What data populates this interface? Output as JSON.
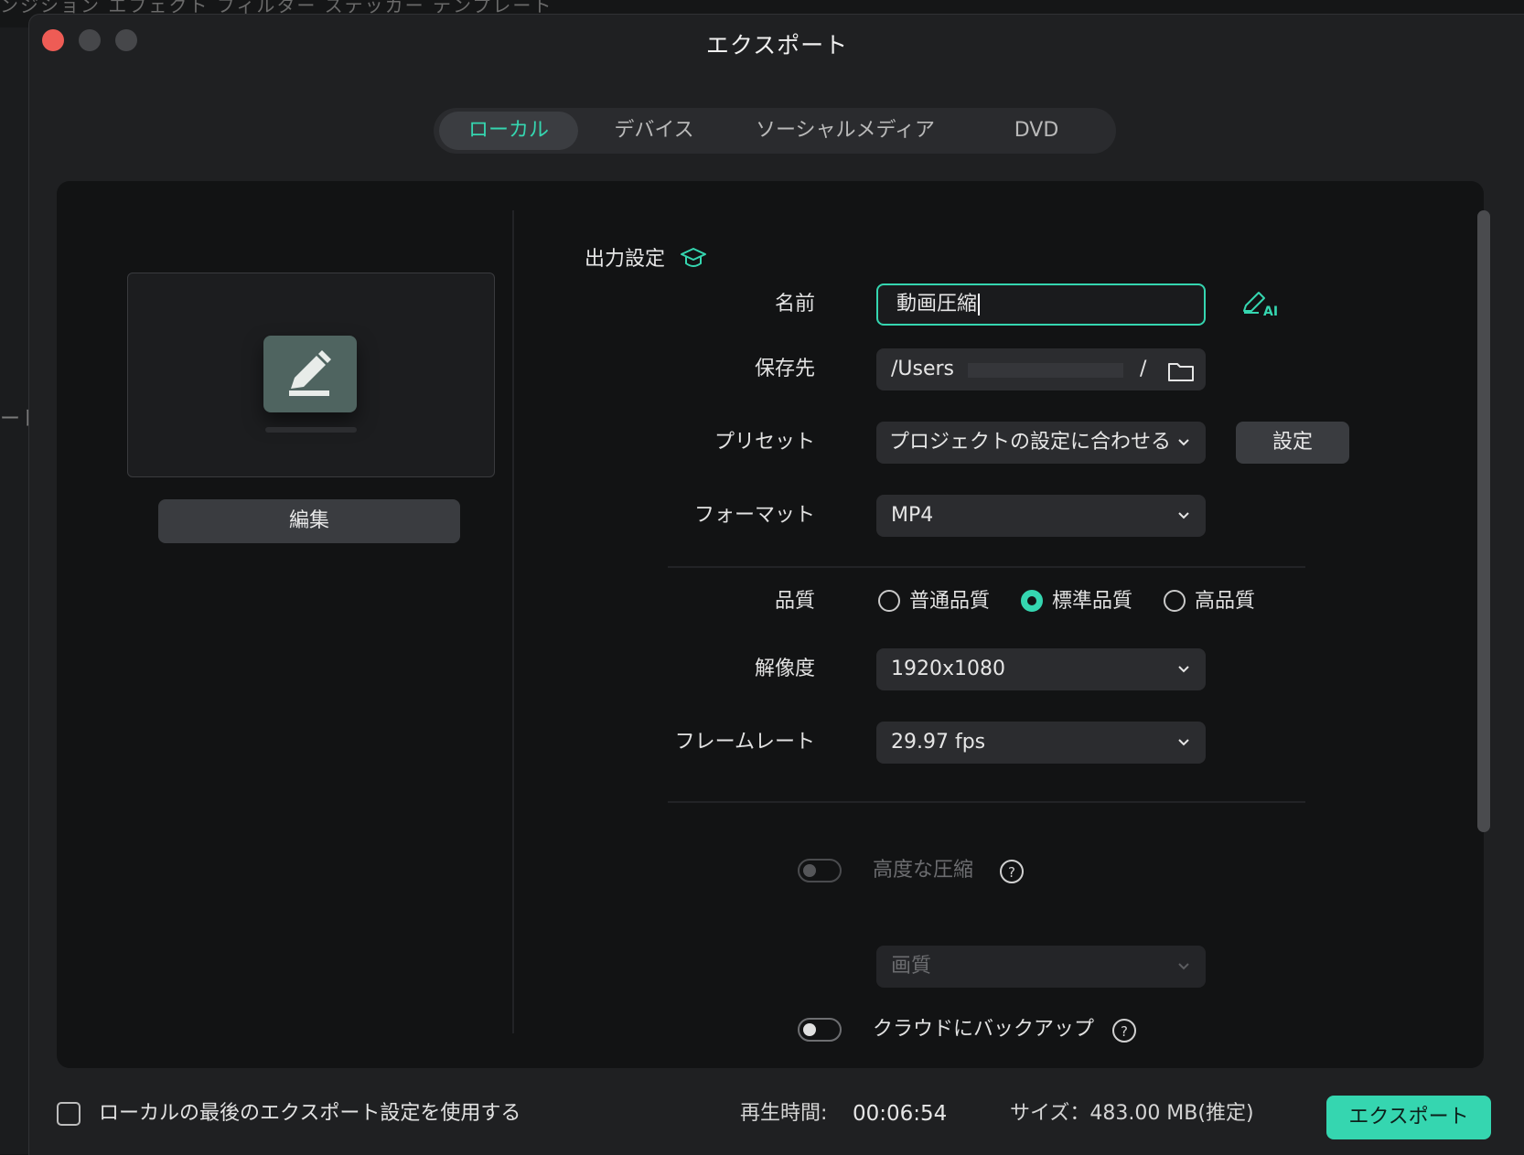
{
  "background_app": {
    "menu_text": "ンジション  エフェクト  フィルター  ステッカー  テンプレート",
    "left_text": "ート"
  },
  "window": {
    "title": "エクスポート"
  },
  "tabs": [
    {
      "label": "ローカル",
      "active": true
    },
    {
      "label": "デバイス",
      "active": false
    },
    {
      "label": "ソーシャルメディア",
      "active": false
    },
    {
      "label": "DVD",
      "active": false
    }
  ],
  "preview": {
    "edit_button": "編集"
  },
  "output_settings": {
    "title": "出力設定",
    "name": {
      "label": "名前",
      "value": "動画圧縮"
    },
    "save_to": {
      "label": "保存先",
      "value_start": "/Users",
      "value_end": "/"
    },
    "preset": {
      "label": "プリセット",
      "value": "プロジェクトの設定に合わせる",
      "settings_button": "設定"
    },
    "format": {
      "label": "フォーマット",
      "value": "MP4"
    },
    "quality": {
      "label": "品質",
      "options": [
        {
          "label": "普通品質",
          "selected": false
        },
        {
          "label": "標準品質",
          "selected": true
        },
        {
          "label": "高品質",
          "selected": false
        }
      ]
    },
    "resolution": {
      "label": "解像度",
      "value": "1920x1080"
    },
    "frame_rate": {
      "label": "フレームレート",
      "value": "29.97 fps"
    },
    "advanced_compression": {
      "label": "高度な圧縮",
      "enabled": false,
      "disabled": true
    },
    "compression_mode": {
      "value": "画質",
      "disabled": true
    },
    "cloud_backup": {
      "label": "クラウドにバックアップ",
      "enabled": false
    }
  },
  "footer": {
    "use_last_settings": "ローカルの最後のエクスポート設定を使用する",
    "duration_label": "再生時間:",
    "duration": "00:06:54",
    "size": "サイズ：483.00 MB(推定)",
    "export_button": "エクスポート"
  },
  "colors": {
    "accent": "#35d6b0",
    "window_bg": "#1f2022",
    "panel_bg": "#121314",
    "close": "#ee5c55"
  }
}
